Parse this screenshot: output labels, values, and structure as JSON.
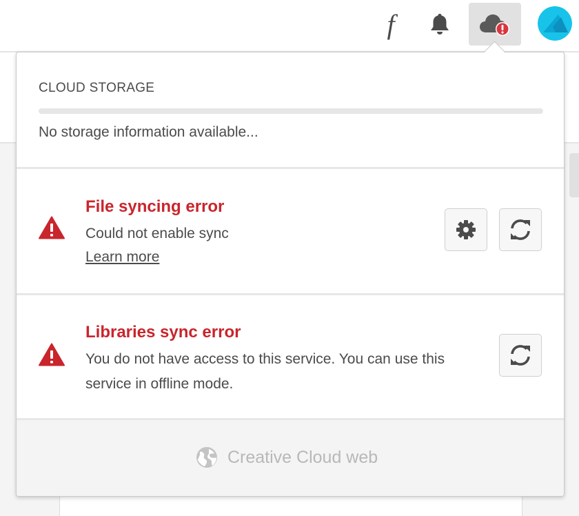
{
  "topbar": {
    "fonts_icon_glyph": "f",
    "icons": [
      "fonts-icon",
      "bell-icon",
      "cloud-error-icon",
      "avatar"
    ]
  },
  "storage": {
    "heading": "CLOUD STORAGE",
    "message": "No storage information available...",
    "used_fraction": 0
  },
  "errors": [
    {
      "title": "File syncing error",
      "description": "Could not enable sync",
      "link": "Learn more",
      "buttons": [
        "gear-icon",
        "sync-icon"
      ]
    },
    {
      "title": "Libraries sync error",
      "description": "You do not have access to this service. You can use this service in offline mode.",
      "buttons": [
        "sync-icon"
      ]
    }
  ],
  "footer": {
    "link_label": "Creative Cloud web",
    "icon": "globe-icon"
  },
  "colors": {
    "error_red": "#c9252c",
    "text_gray": "#4b4b4b",
    "footer_gray": "#b8b8b8",
    "avatar_cyan": "#18c3ea"
  }
}
